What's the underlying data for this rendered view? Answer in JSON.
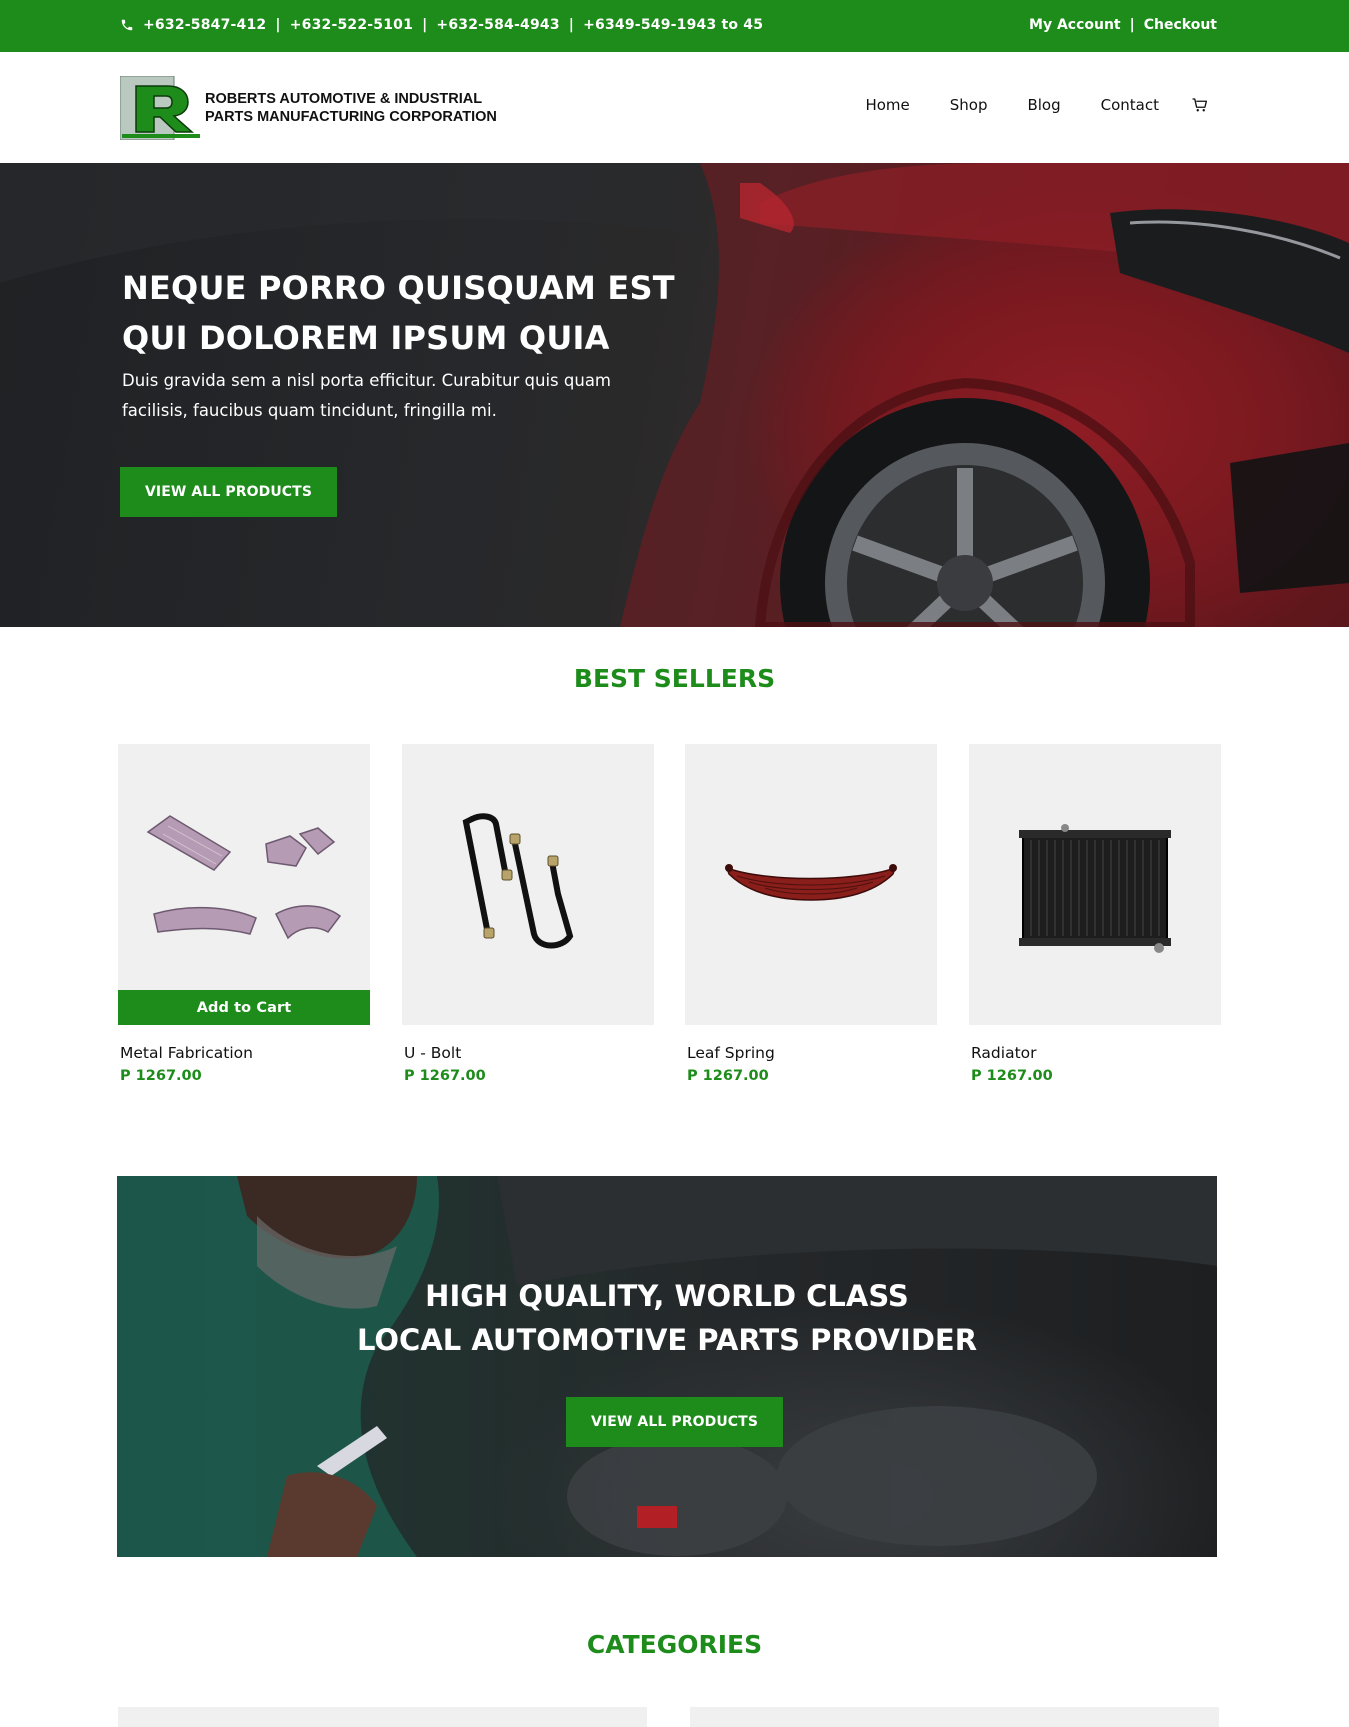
{
  "topbar": {
    "phone_icon": "phone-icon",
    "phones": [
      "+632-5847-412",
      "+632-522-5101",
      "+632-584-4943",
      "+6349-549-1943 to 45"
    ],
    "separator": "|",
    "my_account": "My Account",
    "checkout": "Checkout"
  },
  "header": {
    "brand_line1": "ROBERTS AUTOMOTIVE & INDUSTRIAL",
    "brand_line2": "PARTS MANUFACTURING CORPORATION",
    "nav": [
      "Home",
      "Shop",
      "Blog",
      "Contact"
    ],
    "cart_icon": "cart-icon"
  },
  "hero": {
    "title": "NEQUE PORRO QUISQUAM EST QUI DOLOREM IPSUM QUIA",
    "subtitle": "Duis gravida sem a nisl porta efficitur. Curabitur quis quam facilisis, faucibus quam tincidunt, fringilla mi.",
    "button": "VIEW ALL PRODUCTS"
  },
  "best_sellers": {
    "title": "BEST SELLERS",
    "add_to_cart": "Add to Cart",
    "products": [
      {
        "name": "Metal Fabrication",
        "price": "P 1267.00"
      },
      {
        "name": "U - Bolt",
        "price": "P 1267.00"
      },
      {
        "name": "Leaf Spring",
        "price": "P 1267.00"
      },
      {
        "name": "Radiator",
        "price": "P 1267.00"
      }
    ]
  },
  "banner": {
    "line1": "HIGH QUALITY, WORLD CLASS",
    "line2": "LOCAL AUTOMOTIVE PARTS PROVIDER",
    "button": "VIEW ALL PRODUCTS"
  },
  "categories": {
    "title": "CATEGORIES"
  },
  "colors": {
    "brand_green": "#1e8c1b",
    "product_bg": "#f0f0f0"
  }
}
